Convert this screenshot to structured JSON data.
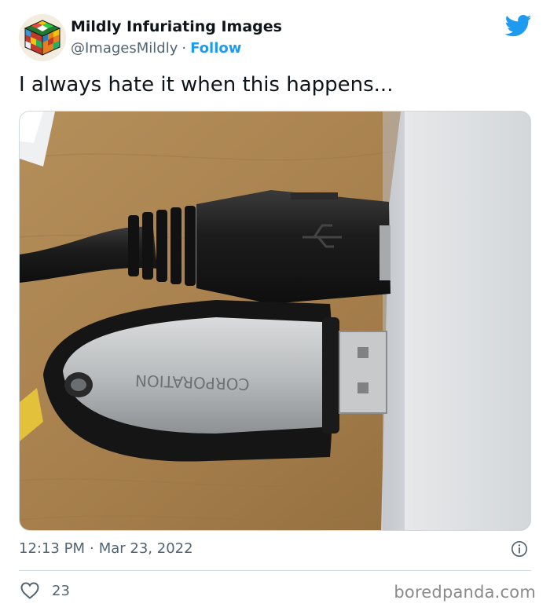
{
  "author": {
    "display_name": "Mildly Infuriating Images",
    "handle": "@ImagesMildly",
    "separator": "·",
    "follow_label": "Follow",
    "avatar_icon": "rubiks-cube-avatar"
  },
  "tweet": {
    "text": "I always hate it when this happens...",
    "time": "12:13 PM",
    "date_separator": "·",
    "date": "Mar 23, 2022",
    "like_count": "23"
  },
  "photo": {
    "usb_stick_engraving": "CORPORATION"
  },
  "watermark": "boredpanda.com",
  "colors": {
    "accent": "#1d9bf0",
    "text": "#0f1419",
    "muted": "#536471"
  }
}
